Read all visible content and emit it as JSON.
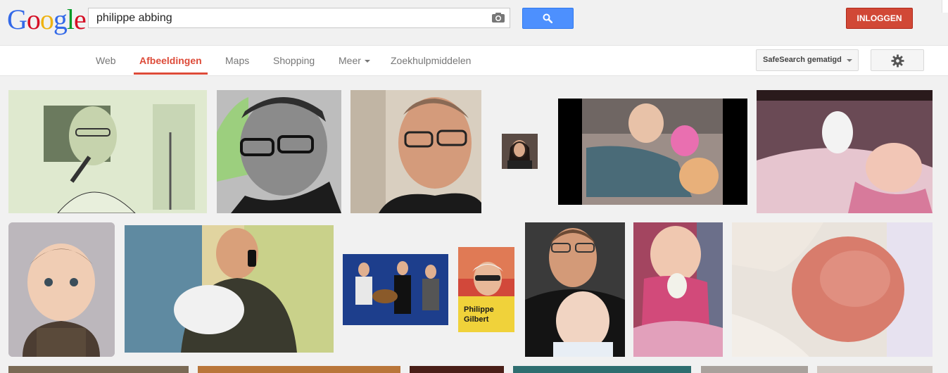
{
  "header": {
    "logo_letters": [
      {
        "char": "G",
        "color": "#3369e8"
      },
      {
        "char": "o",
        "color": "#d50f25"
      },
      {
        "char": "o",
        "color": "#eeb211"
      },
      {
        "char": "g",
        "color": "#3369e8"
      },
      {
        "char": "l",
        "color": "#009925"
      },
      {
        "char": "e",
        "color": "#d50f25"
      }
    ],
    "search_value": "philippe abbing",
    "signin_label": "INLOGGEN"
  },
  "nav": {
    "tabs": [
      {
        "label": "Web",
        "active": false
      },
      {
        "label": "Afbeeldingen",
        "active": true
      },
      {
        "label": "Maps",
        "active": false
      },
      {
        "label": "Shopping",
        "active": false
      },
      {
        "label": "Meer",
        "active": false,
        "dropdown": true
      },
      {
        "label": "Zoekhulpmiddelen",
        "active": false
      }
    ],
    "safesearch_label": "SafeSearch gematigd"
  },
  "results": {
    "rows": [
      [
        {
          "desc": "man-singing-green",
          "bg": "#d7e5c6"
        },
        {
          "desc": "man-glasses-bw",
          "bg": "#9a9a9a"
        },
        {
          "desc": "man-glasses-color",
          "bg": "#c9a489"
        },
        {
          "desc": "woman-small",
          "bg": "#3b2a24"
        },
        {
          "desc": "baby-crawling-video",
          "bg": "#000000"
        },
        {
          "desc": "baby-lying-pink",
          "bg": "#2a1a1c"
        }
      ],
      [
        {
          "desc": "baby-portrait",
          "bg": "#c7c2c6"
        },
        {
          "desc": "man-phone-baby",
          "bg": "#7d9a6a"
        },
        {
          "desc": "band-stage",
          "bg": "#1e3f8a"
        },
        {
          "desc": "cyclist-cover",
          "bg": "#c83a2e"
        },
        {
          "desc": "man-with-baby",
          "bg": "#222222"
        },
        {
          "desc": "baby-pink-blanket",
          "bg": "#b8335a"
        },
        {
          "desc": "newborn-closeup",
          "bg": "#d9c2b0"
        }
      ]
    ]
  }
}
